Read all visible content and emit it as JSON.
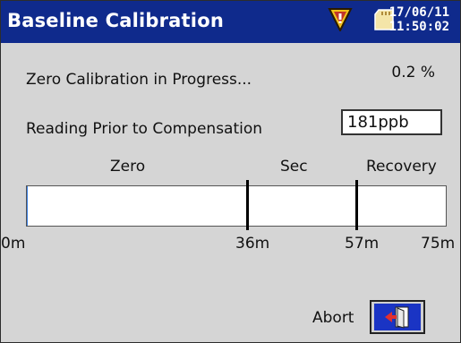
{
  "window": {
    "title": "Baseline Calibration",
    "date": "17/06/11",
    "time": "11:50:02",
    "icons": [
      "warning-icon",
      "memory-card-icon"
    ]
  },
  "status": {
    "message": "Zero Calibration in Progress...",
    "progress_text": "0.2 %",
    "progress_fraction": 0.002
  },
  "reading": {
    "label": "Reading Prior to Compensation",
    "value": "181ppb"
  },
  "timeline": {
    "phases": [
      "Zero",
      "Sec",
      "Recovery"
    ],
    "ticks": [
      "0m",
      "36m",
      "57m",
      "75m"
    ]
  },
  "actions": {
    "abort_label": "Abort",
    "abort_icon": "exit-door-icon"
  },
  "colors": {
    "titlebar": "#0f2a8c",
    "background": "#d5d5d5",
    "icon_red": "#e03030",
    "icon_blue": "#1a34c4"
  }
}
